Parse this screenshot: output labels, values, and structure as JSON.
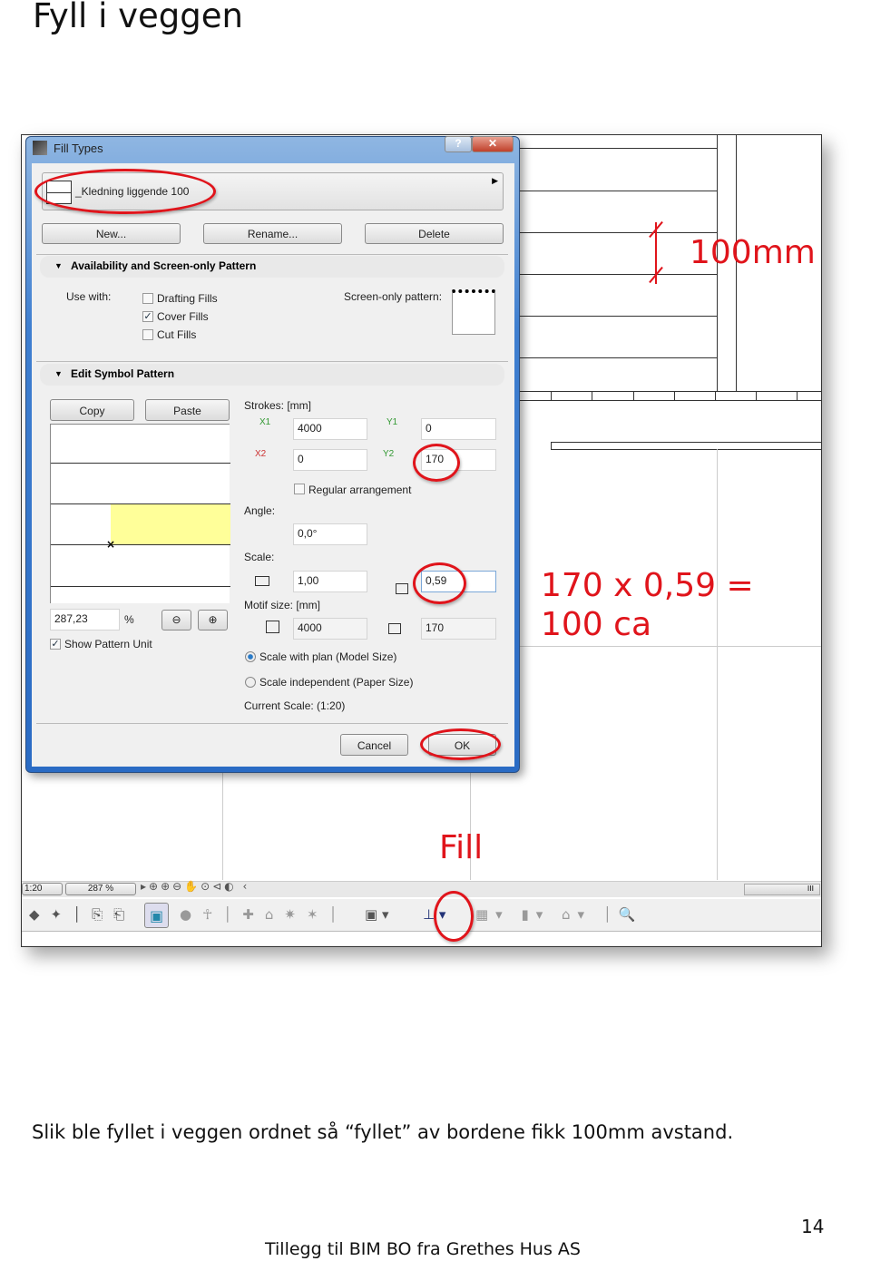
{
  "page_title": "Fyll i veggen",
  "caption": "Slik ble fyllet i veggen ordnet så “fyllet” av bordene fikk 100mm avstand.",
  "page_number": "14",
  "footer": "Tillegg til BIM BO fra Grethes Hus AS",
  "annotations": {
    "dimension": "100mm",
    "calc_line1": "170 x 0,59 =",
    "calc_line2": "100 ca",
    "fill_label": "Fill",
    "color": "#e0141b"
  },
  "dialog": {
    "title": "Fill Types",
    "help": "?",
    "close": "✕",
    "fill_name": "_Kledning liggende 100",
    "buttons": {
      "new": "New...",
      "rename": "Rename...",
      "delete": "Delete",
      "copy": "Copy",
      "paste": "Paste",
      "cancel": "Cancel",
      "ok": "OK"
    },
    "availability": {
      "header": "Availability and Screen-only Pattern",
      "use_with": "Use with:",
      "drafting": "Drafting Fills",
      "cover": "Cover Fills",
      "cut": "Cut Fills",
      "drafting_checked": false,
      "cover_checked": true,
      "cut_checked": false,
      "screen_only": "Screen-only pattern:"
    },
    "edit": {
      "header": "Edit Symbol Pattern",
      "strokes": "Strokes: [mm]",
      "x1_label": "X1",
      "y1_label": "Y1",
      "x2_label": "X2",
      "y2_label": "Y2",
      "x1": "4000",
      "y1": "0",
      "x2": "0",
      "y2": "170",
      "regular": "Regular arrangement",
      "angle_label": "Angle:",
      "angle": "0,0°",
      "scale_label": "Scale:",
      "scale_x": "1,00",
      "scale_y": "0,59",
      "motif_label": "Motif size: [mm]",
      "motif_w": "4000",
      "motif_h": "170",
      "scale_plan": "Scale with plan (Model Size)",
      "scale_indep": "Scale independent (Paper Size)",
      "current_scale": "Current Scale: (1:20)",
      "zoom_value": "287,23",
      "zoom_unit": "%",
      "show_unit": "Show Pattern Unit",
      "show_unit_checked": true,
      "preview_fill": "#ffff99"
    }
  },
  "statusbar": {
    "scale": "1:20",
    "zoom": "287 %"
  }
}
